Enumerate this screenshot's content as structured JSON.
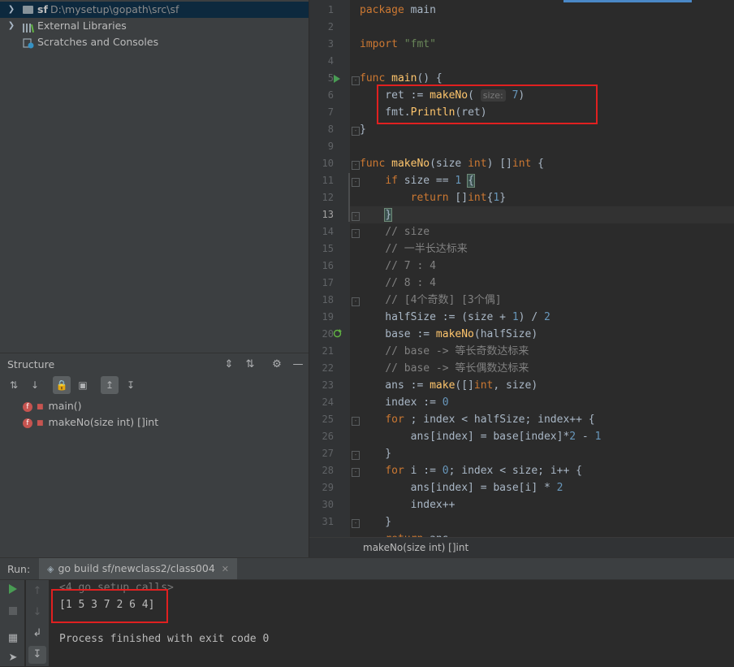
{
  "project": {
    "root_name": "sf",
    "root_path": "D:\\mysetup\\gopath\\src\\sf",
    "external_libraries": "External Libraries",
    "scratches": "Scratches and Consoles"
  },
  "structure": {
    "title": "Structure",
    "items": [
      "main()",
      "makeNo(size int) []int"
    ]
  },
  "editor": {
    "breadcrumb": "makeNo(size int) []int",
    "inlay_hint": "size:",
    "current_line": 13
  },
  "run": {
    "label": "Run:",
    "tab": "go build sf/newclass2/class004",
    "console": [
      "<4 go setup calls>",
      "[1 5 3 7 2 6 4]",
      "",
      "Process finished with exit code 0"
    ]
  },
  "colors": {
    "keyword": "#cc7832",
    "function": "#ffc66d",
    "number": "#6897bb",
    "string": "#6a8759",
    "comment": "#808080",
    "annotation_box": "#e02020"
  }
}
